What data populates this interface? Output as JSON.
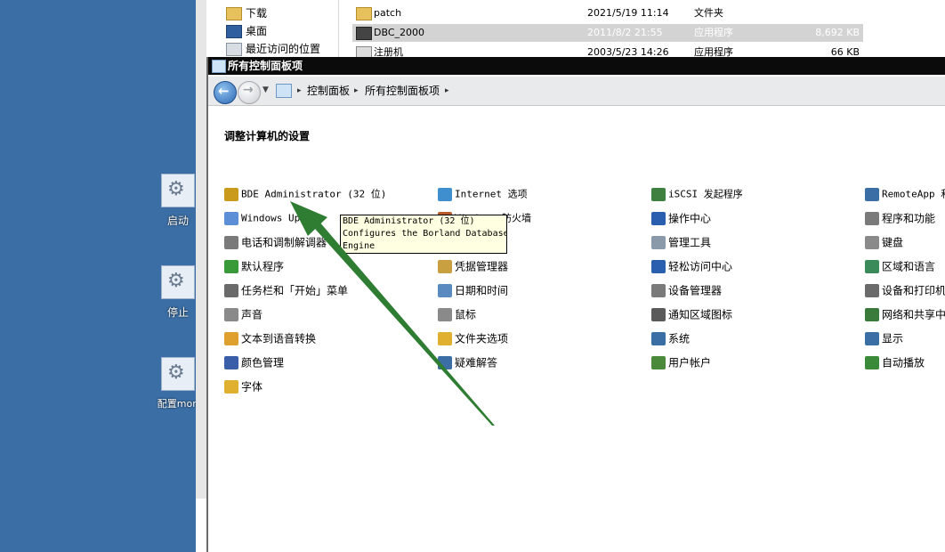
{
  "desktop": {
    "icons": [
      {
        "label": "启动",
        "icon": "gear-icon"
      },
      {
        "label": "停止",
        "icon": "gear-icon"
      },
      {
        "label": "配置mon",
        "icon": "gear-icon"
      }
    ]
  },
  "explorer": {
    "nav_items": [
      {
        "label": "下载",
        "icon": "folder-download-icon"
      },
      {
        "label": "桌面",
        "icon": "desktop-icon"
      },
      {
        "label": "最近访问的位置",
        "icon": "recent-places-icon"
      }
    ],
    "files": [
      {
        "name": "patch",
        "date": "2021/5/19 11:14",
        "type": "文件夹",
        "size": "",
        "icon": "folder-icon"
      },
      {
        "name": "DBC_2000",
        "date": "2011/8/2 21:55",
        "type": "应用程序",
        "size": "8,692 KB",
        "icon": "application-icon",
        "selected": true
      },
      {
        "name": "注册机",
        "date": "2003/5/23 14:26",
        "type": "应用程序",
        "size": "66 KB",
        "icon": "application-icon"
      }
    ]
  },
  "control_panel": {
    "title": "所有控制面板项",
    "breadcrumb": [
      "控制面板",
      "所有控制面板项"
    ],
    "heading": "调整计算机的设置",
    "columns": [
      [
        {
          "label": "BDE Administrator (32 位)",
          "icon": "bde-administrator-icon",
          "color": "#c99a1c"
        },
        {
          "label": "Windows Update",
          "icon": "windows-update-icon",
          "color": "#5c8fd6"
        },
        {
          "label": "电话和调制解调器",
          "icon": "phone-modem-icon",
          "color": "#7a7a7a"
        },
        {
          "label": "默认程序",
          "icon": "default-programs-icon",
          "color": "#3a9a3a"
        },
        {
          "label": "任务栏和「开始」菜单",
          "icon": "taskbar-icon",
          "color": "#6a6a6a"
        },
        {
          "label": "声音",
          "icon": "speaker-icon",
          "color": "#8a8a8a"
        },
        {
          "label": "文本到语音转换",
          "icon": "text-to-speech-icon",
          "color": "#e0a030"
        },
        {
          "label": "颜色管理",
          "icon": "color-management-icon",
          "color": "#3a5fa8"
        },
        {
          "label": "字体",
          "icon": "font-folder-icon",
          "color": "#e0b030"
        }
      ],
      [
        {
          "label": "Internet 选项",
          "icon": "internet-options-icon",
          "color": "#3f8fcf"
        },
        {
          "label": "Windows 防火墙",
          "icon": "firewall-icon",
          "color": "#b85a2a"
        },
        {
          "label": "",
          "icon": "",
          "color": ""
        },
        {
          "label": "凭据管理器",
          "icon": "credential-manager-icon",
          "color": "#c9a040"
        },
        {
          "label": "日期和时间",
          "icon": "date-time-icon",
          "color": "#5a8ac0"
        },
        {
          "label": "鼠标",
          "icon": "mouse-icon",
          "color": "#8a8a8a"
        },
        {
          "label": "文件夹选项",
          "icon": "folder-options-icon",
          "color": "#e0b030"
        },
        {
          "label": "疑难解答",
          "icon": "troubleshooting-icon",
          "color": "#3a6ea5"
        }
      ],
      [
        {
          "label": "iSCSI 发起程序",
          "icon": "iscsi-icon",
          "color": "#3f7f3f"
        },
        {
          "label": "操作中心",
          "icon": "action-center-flag-icon",
          "color": "#2a5fb0"
        },
        {
          "label": "管理工具",
          "icon": "admin-tools-icon",
          "color": "#8a9aaa"
        },
        {
          "label": "轻松访问中心",
          "icon": "ease-of-access-icon",
          "color": "#2a5fb0"
        },
        {
          "label": "设备管理器",
          "icon": "device-manager-icon",
          "color": "#7a7a7a"
        },
        {
          "label": "通知区域图标",
          "icon": "notification-area-icon",
          "color": "#5a5a5a"
        },
        {
          "label": "系统",
          "icon": "system-icon",
          "color": "#3a6ea5"
        },
        {
          "label": "用户帐户",
          "icon": "user-accounts-icon",
          "color": "#4a8a3a"
        }
      ],
      [
        {
          "label": "RemoteApp 和",
          "icon": "remoteapp-icon",
          "color": "#3a6ea5"
        },
        {
          "label": "程序和功能",
          "icon": "programs-features-icon",
          "color": "#7a7a7a"
        },
        {
          "label": "键盘",
          "icon": "keyboard-icon",
          "color": "#8a8a8a"
        },
        {
          "label": "区域和语言",
          "icon": "region-language-icon",
          "color": "#3a8a5a"
        },
        {
          "label": "设备和打印机",
          "icon": "devices-printers-icon",
          "color": "#6a6a6a"
        },
        {
          "label": "网络和共享中",
          "icon": "network-sharing-icon",
          "color": "#3a7a3a"
        },
        {
          "label": "显示",
          "icon": "display-icon",
          "color": "#3a6ea5"
        },
        {
          "label": "自动播放",
          "icon": "autoplay-icon",
          "color": "#3a8a3a"
        }
      ]
    ],
    "tooltip": {
      "lines": [
        "BDE Administrator (32 位)",
        "Configures the Borland Database",
        "Engine"
      ]
    }
  },
  "colors": {
    "desktop_bg": "#3a6ea5",
    "title_bar": "#0b0b0b",
    "arrow": "#2e7d32",
    "tooltip_bg": "#ffffe1"
  }
}
